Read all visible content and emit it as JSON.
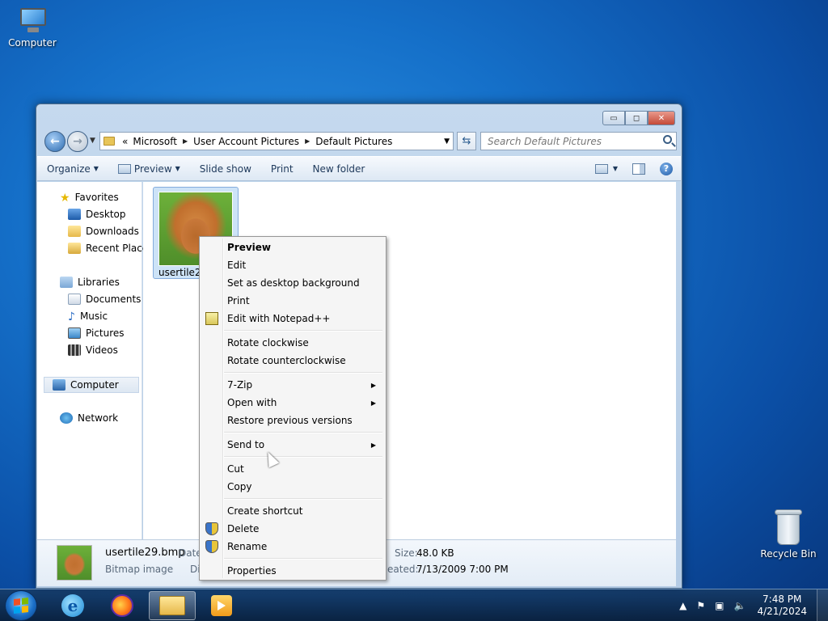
{
  "desktop": {
    "computer_label": "Computer",
    "recycle_label": "Recycle Bin"
  },
  "window": {
    "controls": {
      "minimize": "▭",
      "maximize": "◻",
      "close": "✕"
    },
    "breadcrumb": [
      "Microsoft",
      "User Account Pictures",
      "Default Pictures"
    ],
    "breadcrumb_prefix": "«",
    "search_placeholder": "Search Default Pictures",
    "toolbar": {
      "organize": "Organize",
      "preview": "Preview",
      "slideshow": "Slide show",
      "print": "Print",
      "new_folder": "New folder",
      "help": "?"
    }
  },
  "navpane": {
    "favorites": "Favorites",
    "desktop": "Desktop",
    "downloads": "Downloads",
    "recent": "Recent Places",
    "libraries": "Libraries",
    "documents": "Documents",
    "music": "Music",
    "pictures": "Pictures",
    "videos": "Videos",
    "computer": "Computer",
    "network": "Network"
  },
  "file": {
    "thumb_label": "usertile29.bmp"
  },
  "details": {
    "name": "usertile29.bmp",
    "type": "Bitmap image",
    "date_label": "Date",
    "dim_label": "Di",
    "size_label": "Size:",
    "size_value": "48.0 KB",
    "created_label": "eated:",
    "created_value": "7/13/2009 7:00 PM"
  },
  "context_menu": {
    "preview": "Preview",
    "edit": "Edit",
    "set_background": "Set as desktop background",
    "print": "Print",
    "edit_notepad": "Edit with Notepad++",
    "rotate_cw": "Rotate clockwise",
    "rotate_ccw": "Rotate counterclockwise",
    "zip": "7-Zip",
    "open_with": "Open with",
    "restore": "Restore previous versions",
    "send_to": "Send to",
    "cut": "Cut",
    "copy": "Copy",
    "create_shortcut": "Create shortcut",
    "delete": "Delete",
    "rename": "Rename",
    "properties": "Properties"
  },
  "taskbar": {
    "time": "7:48 PM",
    "date": "4/21/2024"
  },
  "colors": {
    "accent": "#1570c9",
    "menu_bg": "#f5f5f5",
    "selection": "#cde3f7"
  }
}
